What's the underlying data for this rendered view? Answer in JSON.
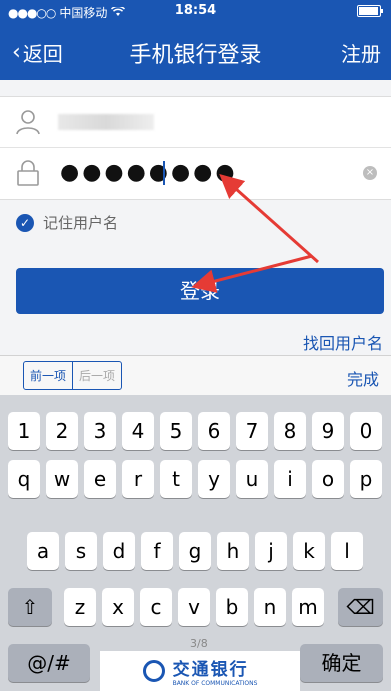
{
  "status_bar": {
    "carrier": "中国移动",
    "time": "18:54"
  },
  "nav": {
    "back_label": "返回",
    "title": "手机银行登录",
    "register_label": "注册"
  },
  "form": {
    "password_mask": "●●●●●●●●",
    "clear_icon": "×"
  },
  "remember": {
    "label": "记住用户名",
    "checked": true
  },
  "login_button": "登录",
  "forgot_username": "找回用户名",
  "keyboard_toolbar": {
    "prev": "前一项",
    "next": "后一项",
    "done": "完成"
  },
  "keyboard": {
    "row1": [
      "1",
      "2",
      "3",
      "4",
      "5",
      "6",
      "7",
      "8",
      "9",
      "0"
    ],
    "row2": [
      "q",
      "w",
      "e",
      "r",
      "t",
      "y",
      "u",
      "i",
      "o",
      "p"
    ],
    "row3": [
      "a",
      "s",
      "d",
      "f",
      "g",
      "h",
      "j",
      "k",
      "l"
    ],
    "row4": [
      "z",
      "x",
      "c",
      "v",
      "b",
      "n",
      "m"
    ],
    "shift": "⇧",
    "delete": "⌫",
    "symbols": "@/#",
    "confirm": "确定",
    "page": "3/8"
  },
  "brand": {
    "cn": "交通银行",
    "en": "BANK OF COMMUNICATIONS"
  },
  "colors": {
    "primary": "#1a56b3",
    "arrow": "#e53b35"
  }
}
